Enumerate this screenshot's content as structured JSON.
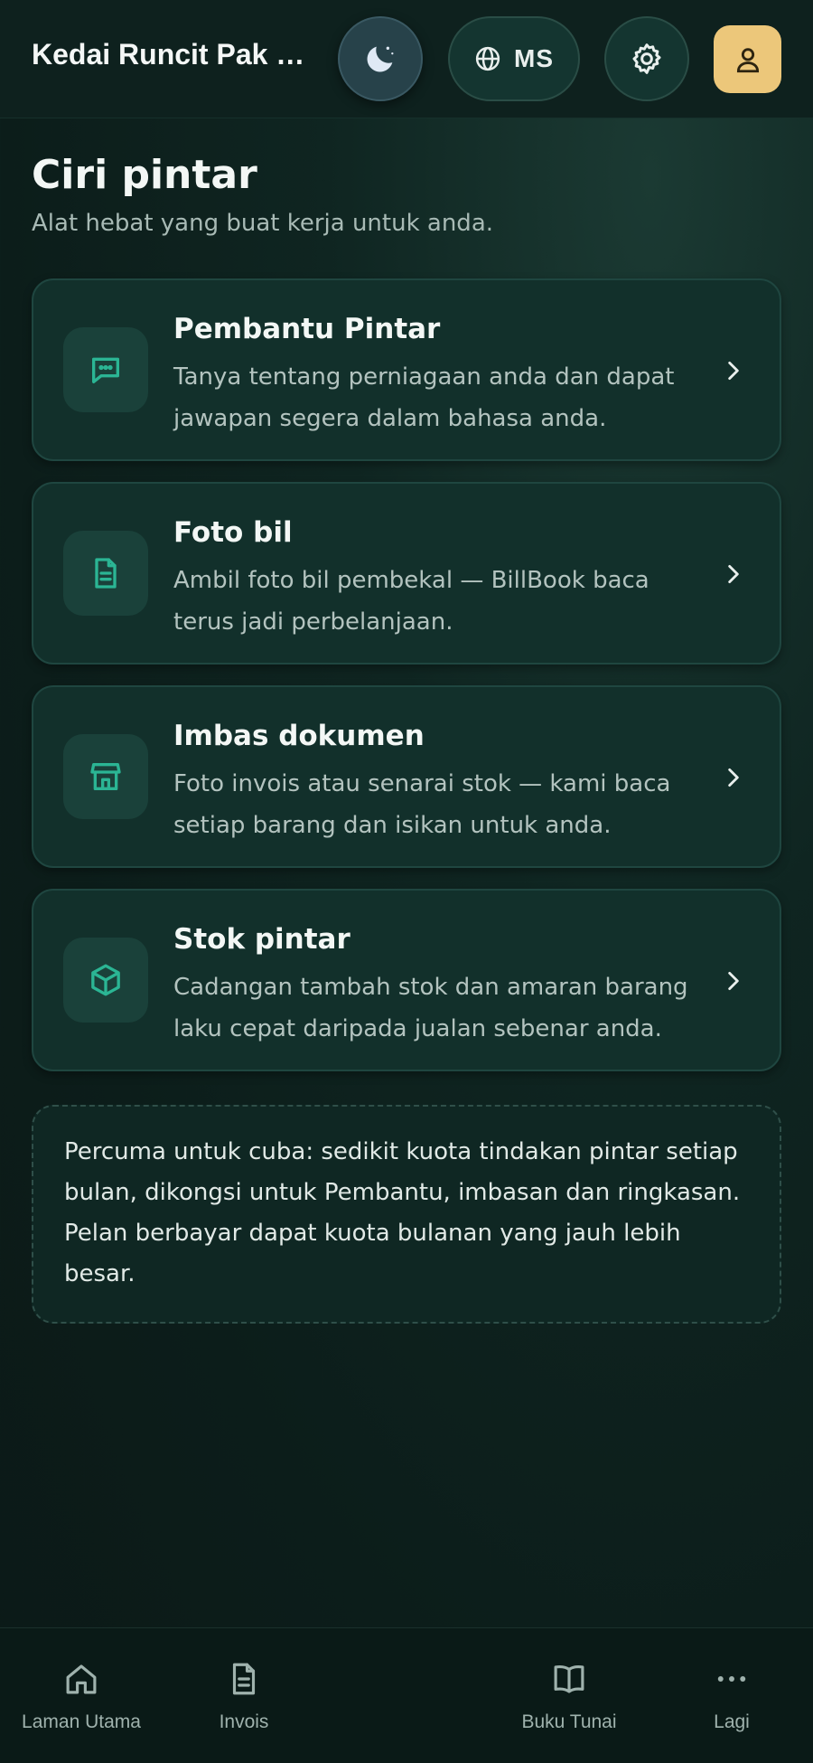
{
  "header": {
    "shop_name": "Kedai Runcit Pak Lah",
    "language_code": "MS",
    "icons": [
      "moon-icon",
      "globe-icon",
      "gear-icon",
      "user-icon"
    ]
  },
  "page": {
    "title": "Ciri pintar",
    "subtitle": "Alat hebat yang buat kerja untuk anda."
  },
  "features": [
    {
      "title": "Pembantu Pintar",
      "description": "Tanya tentang perniagaan anda dan dapat jawapan segera dalam bahasa anda.",
      "icon": "chat-icon"
    },
    {
      "title": "Foto bil",
      "description": "Ambil foto bil pembekal — BillBook baca terus jadi perbelanjaan.",
      "icon": "receipt-icon"
    },
    {
      "title": "Imbas dokumen",
      "description": "Foto invois atau senarai stok — kami baca setiap barang dan isikan untuk anda.",
      "icon": "store-icon"
    },
    {
      "title": "Stok pintar",
      "description": "Cadangan tambah stok dan amaran barang laku cepat daripada jualan sebenar anda.",
      "icon": "box-icon"
    }
  ],
  "note": "Percuma untuk cuba: sedikit kuota tindakan pintar setiap bulan, dikongsi untuk Pembantu, imbasan dan ringkasan. Pelan berbayar dapat kuota bulanan yang jauh lebih besar.",
  "bottom_nav": [
    {
      "label": "Laman Utama",
      "icon": "home-icon"
    },
    {
      "label": "Invois",
      "icon": "document-icon"
    },
    {
      "label": "Buku Tunai",
      "icon": "book-icon"
    },
    {
      "label": "Lagi",
      "icon": "more-icon"
    }
  ],
  "colors": {
    "accent": "#2bb594",
    "profile_button": "#ecc77a",
    "background": "#0c1d1a",
    "card": "#12302b"
  }
}
